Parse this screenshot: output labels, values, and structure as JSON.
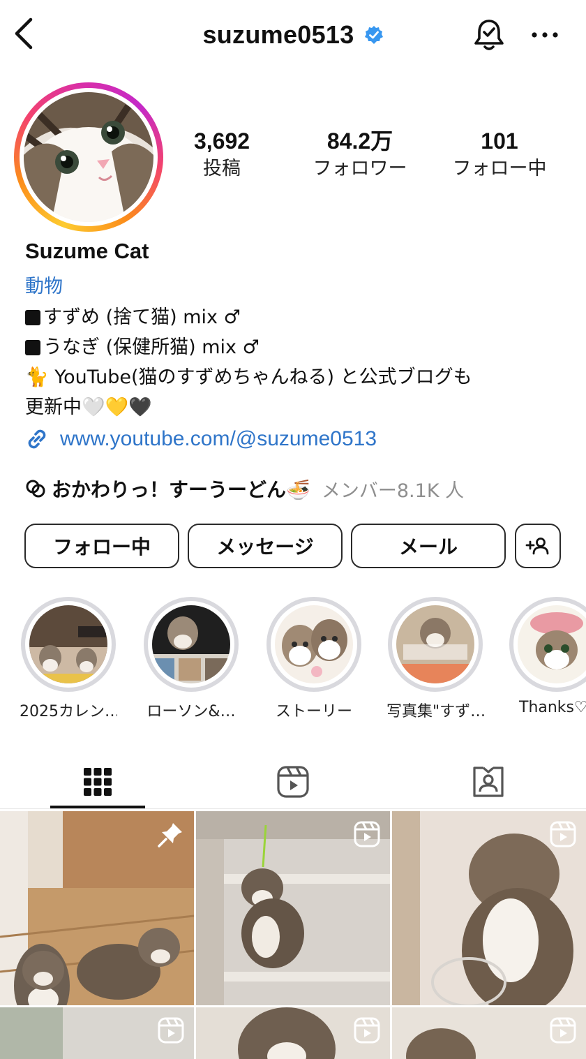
{
  "header": {
    "username": "suzume0513",
    "verified_icon": "verified-badge-icon",
    "back_icon": "chevron-left-icon",
    "bell_icon": "bell-check-icon",
    "more_icon": "more-dots-icon"
  },
  "stats": [
    {
      "value": "3,692",
      "label": "投稿"
    },
    {
      "value": "84.2万",
      "label": "フォロワー"
    },
    {
      "value": "101",
      "label": "フォロー中"
    }
  ],
  "profile": {
    "display_name": "Suzume Cat",
    "category": "動物",
    "bio_line1": "すずめ (捨て猫) mix ♂",
    "bio_line2": "うなぎ (保健所猫) mix ♂",
    "bio_line3": "🐈 YouTube(猫のすずめちゃんねる) と公式ブログも",
    "bio_line4": "更新中🤍💛🖤",
    "link": "www.youtube.com/@suzume0513"
  },
  "channel": {
    "name": "おかわりっ！すーうーどん🍜",
    "members": "メンバー8.1K 人"
  },
  "buttons": {
    "following": "フォロー中",
    "message": "メッセージ",
    "mail": "メール"
  },
  "highlights": [
    {
      "label": "2025カレン…"
    },
    {
      "label": "ローソン&…"
    },
    {
      "label": "ストーリー"
    },
    {
      "label": "写真集\"すず…"
    },
    {
      "label": "Thanks♡"
    }
  ],
  "colors": {
    "accent_link": "#2f75c9",
    "secondary_text": "#8e8e8e",
    "verified": "#3897f0"
  }
}
